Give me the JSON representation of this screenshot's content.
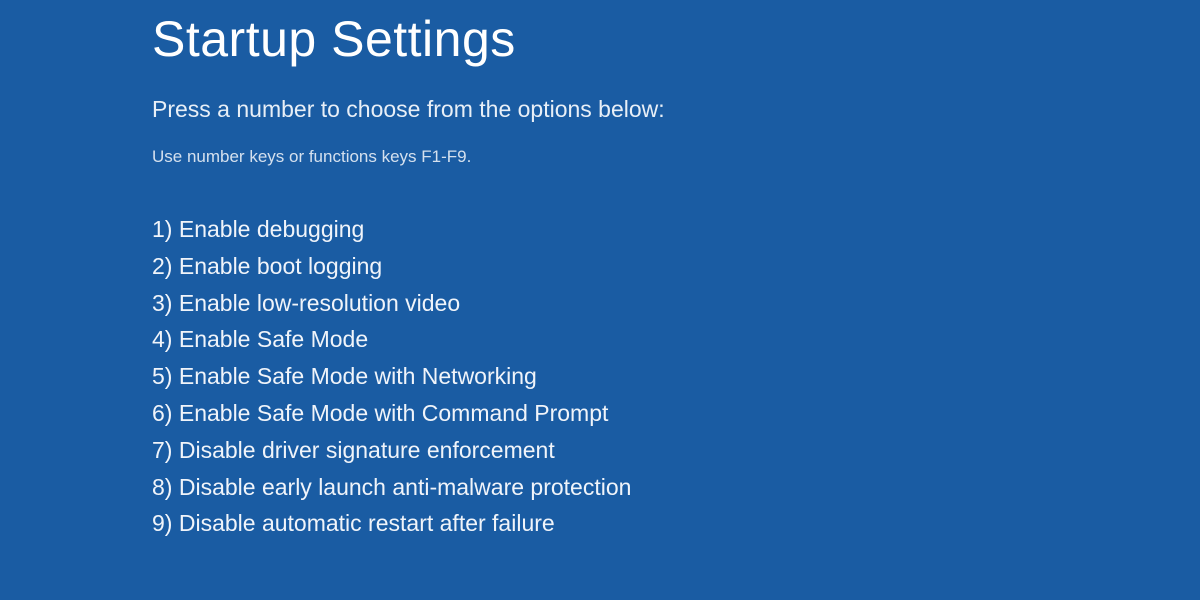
{
  "screen": {
    "title": "Startup Settings",
    "instruction": "Press a number to choose from the options below:",
    "hint": "Use number keys or functions keys F1-F9.",
    "options": [
      {
        "number": "1",
        "label": "Enable debugging"
      },
      {
        "number": "2",
        "label": "Enable boot logging"
      },
      {
        "number": "3",
        "label": "Enable low-resolution video"
      },
      {
        "number": "4",
        "label": "Enable Safe Mode"
      },
      {
        "number": "5",
        "label": "Enable Safe Mode with Networking"
      },
      {
        "number": "6",
        "label": "Enable Safe Mode with Command Prompt"
      },
      {
        "number": "7",
        "label": "Disable driver signature enforcement"
      },
      {
        "number": "8",
        "label": "Disable early launch anti-malware protection"
      },
      {
        "number": "9",
        "label": "Disable automatic restart after failure"
      }
    ]
  },
  "colors": {
    "background": "#1a5ca3",
    "text": "#ffffff"
  }
}
